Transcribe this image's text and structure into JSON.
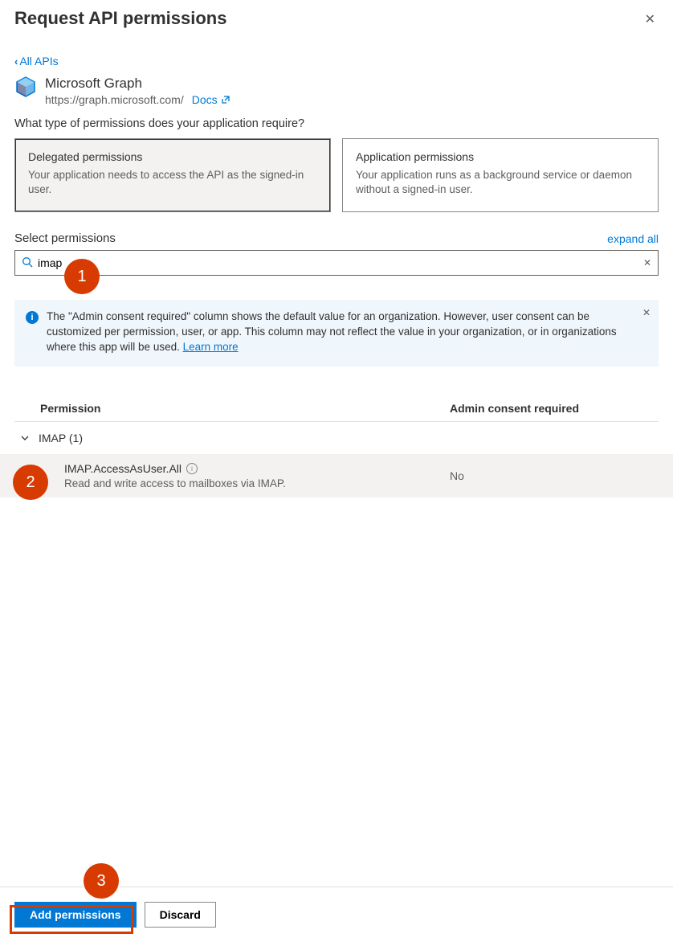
{
  "title": "Request API permissions",
  "back_link": "All APIs",
  "api": {
    "name": "Microsoft Graph",
    "url": "https://graph.microsoft.com/",
    "docs_label": "Docs"
  },
  "permission_type_question": "What type of permissions does your application require?",
  "perm_types": {
    "delegated": {
      "title": "Delegated permissions",
      "desc": "Your application needs to access the API as the signed-in user."
    },
    "application": {
      "title": "Application permissions",
      "desc": "Your application runs as a background service or daemon without a signed-in user."
    }
  },
  "select_label": "Select permissions",
  "expand_all": "expand all",
  "search": {
    "value": "imap",
    "placeholder": ""
  },
  "info_banner": {
    "text": "The \"Admin consent required\" column shows the default value for an organization. However, user consent can be customized per permission, user, or app. This column may not reflect the value in your organization, or in organizations where this app will be used.  ",
    "learn_more": "Learn more"
  },
  "columns": {
    "permission": "Permission",
    "admin": "Admin consent required"
  },
  "group": {
    "label": "IMAP (1)"
  },
  "permission_item": {
    "id": "IMAP.AccessAsUser.All",
    "desc": "Read and write access to mailboxes via IMAP.",
    "admin": "No",
    "checked": true
  },
  "footer": {
    "add": "Add permissions",
    "discard": "Discard"
  },
  "annotations": {
    "step1": "1",
    "step2": "2",
    "step3": "3"
  }
}
